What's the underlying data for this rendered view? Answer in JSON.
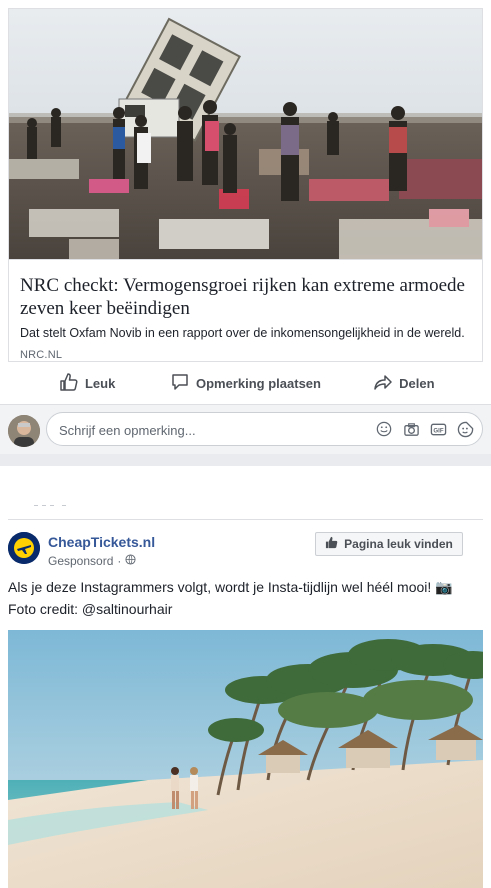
{
  "post1": {
    "headline": "NRC checkt: Vermogensgroei rijken kan extreme armoede zeven keer beëindigen",
    "description": "Dat stelt Oxfam Novib in een rapport over de inkomensongelijkheid in de wereld.",
    "domain": "NRC.NL",
    "hero_image": "landfill-scene"
  },
  "actions": {
    "like_label": "Leuk",
    "comment_label": "Opmerking plaatsen",
    "share_label": "Delen"
  },
  "comment_box": {
    "placeholder": "Schrijf een opmerking...",
    "icons": [
      "emoji-icon",
      "camera-icon",
      "gif-icon",
      "sticker-icon"
    ]
  },
  "post2": {
    "page_name": "CheapTickets.nl",
    "sponsored_label": "Gesponsord",
    "like_page_label": "Pagina leuk vinden",
    "text_line1": "Als je deze Instagrammers volgt, wordt je Insta-tijdlijn wel héél mooi! 📷",
    "text_line2": "Foto credit: @saltinourhair",
    "image": "tropical-beach"
  },
  "colors": {
    "link_blue": "#365899",
    "text_gray": "#4b4f56",
    "border": "#dddfe2",
    "background_gray": "#f2f3f5"
  }
}
